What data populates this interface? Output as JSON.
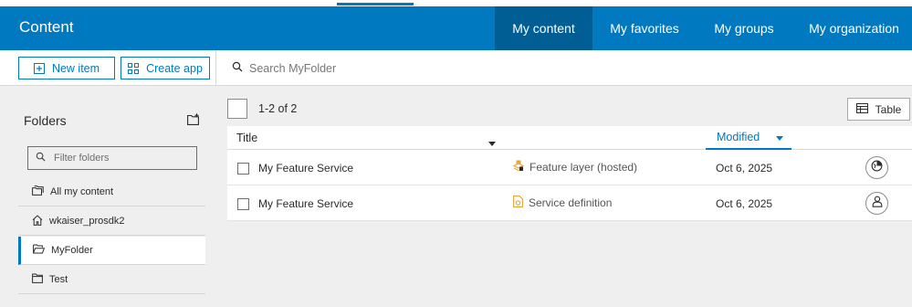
{
  "header": {
    "title": "Content",
    "tabs": [
      {
        "label": "My content",
        "active": true
      },
      {
        "label": "My favorites",
        "active": false
      },
      {
        "label": "My groups",
        "active": false
      },
      {
        "label": "My organization",
        "active": false
      }
    ]
  },
  "toolbar": {
    "new_item_label": "New item",
    "create_app_label": "Create app",
    "search_placeholder": "Search MyFolder"
  },
  "sidebar": {
    "heading": "Folders",
    "filter_placeholder": "Filter folders",
    "folders": [
      {
        "label": "All my content",
        "icon": "all-content-icon"
      },
      {
        "label": "wkaiser_prosdk2",
        "icon": "home-icon"
      },
      {
        "label": "MyFolder",
        "icon": "folder-open-icon",
        "active": true
      },
      {
        "label": "Test",
        "icon": "folder-icon"
      }
    ]
  },
  "main": {
    "count_label": "1-2 of 2",
    "view_label": "Table",
    "columns": {
      "title": "Title",
      "modified": "Modified"
    },
    "rows": [
      {
        "title": "My Feature Service",
        "type": "Feature layer (hosted)",
        "type_icon": "feature-layer-hosted-icon",
        "modified": "Oct 6, 2025",
        "sharing_icon": "shared-organization-icon"
      },
      {
        "title": "My Feature Service",
        "type": "Service definition",
        "type_icon": "service-definition-icon",
        "modified": "Oct 6, 2025",
        "sharing_icon": "owner-only-icon"
      }
    ]
  },
  "colors": {
    "brand_blue": "#0079c1",
    "active_tab": "#005e95",
    "type_icon_orange": "#e8a53a"
  }
}
